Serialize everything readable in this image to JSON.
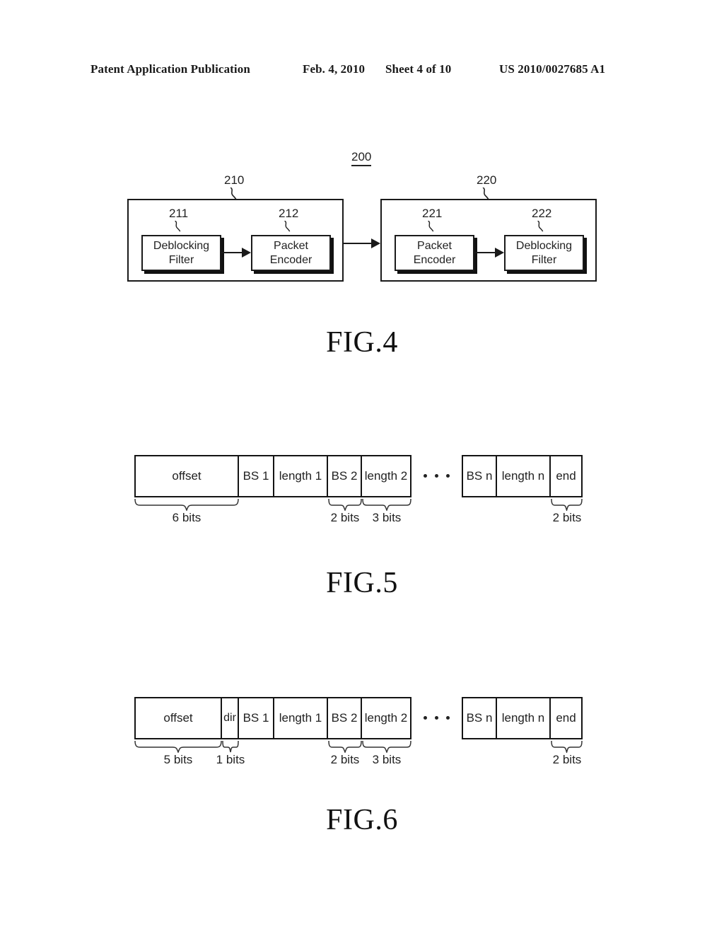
{
  "header": {
    "title": "Patent Application Publication",
    "date": "Feb. 4, 2010",
    "sheet": "Sheet 4 of 10",
    "pub_number": "US 2010/0027685 A1"
  },
  "figures": [
    {
      "id": "fig4",
      "caption": "FIG.4",
      "system_ref": "200",
      "blocks": [
        {
          "ref": "210",
          "children": [
            {
              "ref": "211",
              "line1": "Deblocking",
              "line2": "Filter"
            },
            {
              "ref": "212",
              "line1": "Packet",
              "line2": "Encoder"
            }
          ]
        },
        {
          "ref": "220",
          "children": [
            {
              "ref": "221",
              "line1": "Packet",
              "line2": "Encoder"
            },
            {
              "ref": "222",
              "line1": "Deblocking",
              "line2": "Filter"
            }
          ]
        }
      ]
    },
    {
      "id": "fig5",
      "caption": "FIG.5",
      "left_cells": [
        "offset",
        "BS 1",
        "length 1",
        "BS 2",
        "length 2"
      ],
      "right_cells": [
        "BS n",
        "length n",
        "end"
      ],
      "separator": "...",
      "bit_labels": [
        "6 bits",
        "2 bits",
        "3 bits",
        "2 bits"
      ]
    },
    {
      "id": "fig6",
      "caption": "FIG.6",
      "left_cells": [
        "offset",
        "dir",
        "BS 1",
        "length 1",
        "BS 2",
        "length 2"
      ],
      "right_cells": [
        "BS n",
        "length n",
        "end"
      ],
      "separator": "...",
      "bit_labels": [
        "5 bits",
        "1 bits",
        "2 bits",
        "3 bits",
        "2 bits"
      ]
    }
  ]
}
